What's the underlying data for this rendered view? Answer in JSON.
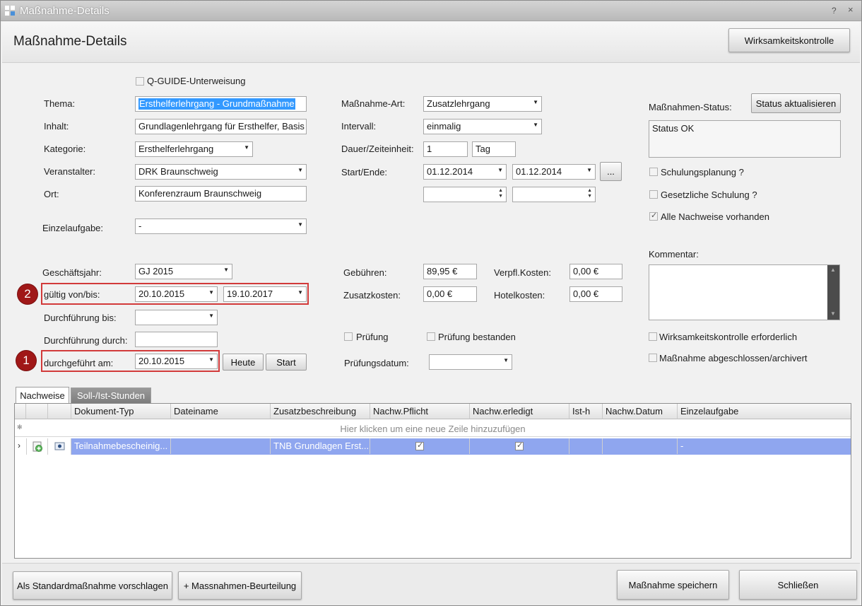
{
  "window": {
    "title": "Maßnahme-Details"
  },
  "header": {
    "title": "Maßnahme-Details",
    "effectiveness_button": "Wirksamkeitskontrolle"
  },
  "form": {
    "qguide_label": "Q-GUIDE-Unterweisung",
    "thema": {
      "label": "Thema:",
      "value": "Ersthelferlehrgang - Grundmaßnahme"
    },
    "inhalt": {
      "label": "Inhalt:",
      "value": "Grundlagenlehrgang für Ersthelfer, Basis"
    },
    "kategorie": {
      "label": "Kategorie:",
      "value": "Ersthelferlehrgang"
    },
    "veranstalter": {
      "label": "Veranstalter:",
      "value": "DRK Braunschweig"
    },
    "ort": {
      "label": "Ort:",
      "value": "Konferenzraum Braunschweig"
    },
    "einzelaufgabe": {
      "label": "Einzelaufgabe:",
      "value": "-"
    },
    "geschaeftsjahr": {
      "label": "Geschäftsjahr:",
      "value": "GJ 2015"
    },
    "gueltig": {
      "label": "gültig von/bis:",
      "from": "20.10.2015",
      "to": "19.10.2017"
    },
    "durchfuehrung_bis": {
      "label": "Durchführung bis:",
      "value": ""
    },
    "durchfuehrung_durch": {
      "label": "Durchführung durch:",
      "value": ""
    },
    "durchgefuehrt_am": {
      "label": "durchgeführt am:",
      "value": "20.10.2015"
    },
    "heute_button": "Heute",
    "start_button": "Start",
    "massnahme_art": {
      "label": "Maßnahme-Art:",
      "value": "Zusatzlehrgang"
    },
    "intervall": {
      "label": "Intervall:",
      "value": "einmalig"
    },
    "dauer": {
      "label": "Dauer/Zeiteinheit:",
      "value": "1",
      "unit": "Tag"
    },
    "start_ende": {
      "label": "Start/Ende:",
      "start": "01.12.2014",
      "end": "01.12.2014",
      "more_button": "..."
    },
    "gebuehren": {
      "label": "Gebühren:",
      "value": "89,95 €"
    },
    "verpfl_kosten": {
      "label": "Verpfl.Kosten:",
      "value": "0,00 €"
    },
    "zusatzkosten": {
      "label": "Zusatzkosten:",
      "value": "0,00 €"
    },
    "hotelkosten": {
      "label": "Hotelkosten:",
      "value": "0,00 €"
    },
    "pruefung": {
      "label": "Prüfung"
    },
    "pruefung_bestanden": {
      "label": "Prüfung bestanden"
    },
    "pruefungsdatum": {
      "label": "Prüfungsdatum:",
      "value": ""
    }
  },
  "status": {
    "label": "Maßnahmen-Status:",
    "update_button": "Status aktualisieren",
    "value": "Status OK",
    "schulungsplanung": "Schulungsplanung ?",
    "gesetzliche_schulung": "Gesetzliche Schulung ?",
    "alle_nachweise": "Alle Nachweise vorhanden",
    "kommentar_label": "Kommentar:",
    "kommentar_value": "",
    "wirksamkeit_erforderlich": "Wirksamkeitskontrolle erforderlich",
    "abgeschlossen": "Maßnahme abgeschlossen/archivert"
  },
  "annotations": {
    "badge1": "1",
    "badge2": "2"
  },
  "tabs": [
    {
      "label": "Nachweise"
    },
    {
      "label": "Soll-/Ist-Stunden"
    }
  ],
  "grid": {
    "columns": [
      "Dokument-Typ",
      "Dateiname",
      "Zusatzbeschreibung",
      "Nachw.Pflicht",
      "Nachw.erledigt",
      "Ist-h",
      "Nachw.Datum",
      "Einzelaufgabe"
    ],
    "new_row_hint": "Hier klicken um eine neue Zeile hinzuzufügen",
    "new_row_marker": "✻",
    "rows": [
      {
        "dokument_typ": "Teilnahmebescheinig...",
        "dateiname": "",
        "zusatzbeschreibung": "TNB Grundlagen Erst...",
        "pflicht": true,
        "erledigt": true,
        "ist_h": "",
        "datum": "",
        "einzelaufgabe": "-"
      }
    ]
  },
  "footer": {
    "standard_button": "Als Standardmaßnahme vorschlagen",
    "beurteilung_button": "+ Massnahmen-Beurteilung",
    "save_button": "Maßnahme speichern",
    "close_button": "Schließen"
  },
  "colors": {
    "accent_selection": "#3399ff",
    "row_selected": "#8fa6ef",
    "annotation_red": "#d23a3a",
    "badge": "#a01818"
  }
}
